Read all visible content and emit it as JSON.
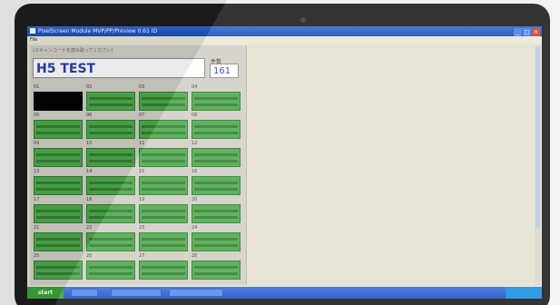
{
  "window": {
    "title": "PixelScreen Module MVP/PP/Preview 0.61 ID",
    "menu": "File"
  },
  "panel": {
    "hint": "(スキャンコードを読み取ってください)",
    "label_value": "H5 TEST",
    "count_label": "件数",
    "count_value": "161"
  },
  "cells": [
    {
      "tag": "01",
      "state": "off"
    },
    {
      "tag": "02",
      "state": "on"
    },
    {
      "tag": "03",
      "state": "on"
    },
    {
      "tag": "04",
      "state": "on"
    },
    {
      "tag": "05",
      "state": "on"
    },
    {
      "tag": "06",
      "state": "on"
    },
    {
      "tag": "07",
      "state": "on"
    },
    {
      "tag": "08",
      "state": "on"
    },
    {
      "tag": "09",
      "state": "on"
    },
    {
      "tag": "10",
      "state": "on"
    },
    {
      "tag": "11",
      "state": "on"
    },
    {
      "tag": "12",
      "state": "on"
    },
    {
      "tag": "13",
      "state": "on"
    },
    {
      "tag": "14",
      "state": "on"
    },
    {
      "tag": "15",
      "state": "on"
    },
    {
      "tag": "16",
      "state": "on"
    },
    {
      "tag": "17",
      "state": "on"
    },
    {
      "tag": "18",
      "state": "on"
    },
    {
      "tag": "19",
      "state": "on"
    },
    {
      "tag": "20",
      "state": "on"
    },
    {
      "tag": "21",
      "state": "on"
    },
    {
      "tag": "22",
      "state": "on"
    },
    {
      "tag": "23",
      "state": "on"
    },
    {
      "tag": "24",
      "state": "on"
    },
    {
      "tag": "25",
      "state": "on"
    },
    {
      "tag": "26",
      "state": "on"
    },
    {
      "tag": "27",
      "state": "on"
    },
    {
      "tag": "28",
      "state": "on"
    }
  ],
  "taskbar": {
    "start_label": "start"
  },
  "colors": {
    "slot_on": "#4faa4c",
    "slot_off": "#050505",
    "titlebar": "#2f6bd6",
    "label_text": "#2a3eb4"
  }
}
